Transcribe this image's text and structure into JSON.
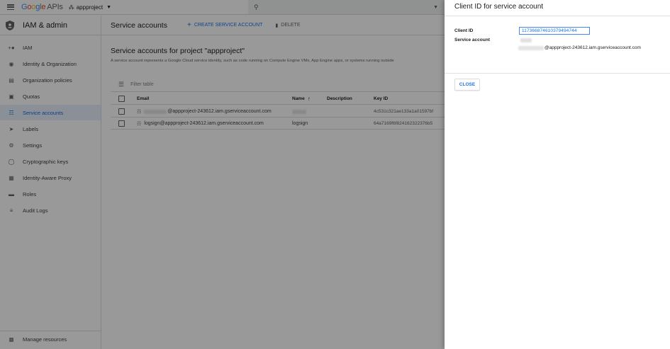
{
  "topbar": {
    "logo_letters": [
      "G",
      "o",
      "o",
      "g",
      "l",
      "e"
    ],
    "logo_suffix": "APIs",
    "project": "appproject",
    "icons": {
      "menu": "hamburger-icon",
      "search": "search-icon",
      "project": "project-dots-icon"
    }
  },
  "sidebar": {
    "title": "IAM & admin",
    "items": [
      {
        "label": "IAM",
        "icon": "person-add-icon"
      },
      {
        "label": "Identity & Organization",
        "icon": "account-circle-icon"
      },
      {
        "label": "Organization policies",
        "icon": "policy-doc-icon"
      },
      {
        "label": "Quotas",
        "icon": "quota-icon"
      },
      {
        "label": "Service accounts",
        "icon": "service-account-icon",
        "active": true
      },
      {
        "label": "Labels",
        "icon": "label-icon"
      },
      {
        "label": "Settings",
        "icon": "settings-gear-icon"
      },
      {
        "label": "Cryptographic keys",
        "icon": "crypto-key-icon"
      },
      {
        "label": "Identity-Aware Proxy",
        "icon": "proxy-icon"
      },
      {
        "label": "Roles",
        "icon": "roles-icon"
      },
      {
        "label": "Audit Logs",
        "icon": "audit-logs-icon"
      }
    ],
    "manage": "Manage resources"
  },
  "main": {
    "header": "Service accounts",
    "create_label": "CREATE SERVICE ACCOUNT",
    "delete_label": "DELETE",
    "section_title": "Service accounts for project \"appproject\"",
    "description": "A service account represents a Google Cloud service identity, such as code running on Compute Engine VMs, App Engine apps, or systems running outside",
    "filter_placeholder": "Filter table",
    "columns": {
      "email": "Email",
      "name": "Name",
      "description": "Description",
      "key_id": "Key ID"
    },
    "rows": [
      {
        "email_suffix": "@appproject-243612.iam.gserviceaccount.com",
        "name": "",
        "key_id": "4c531c321ae133a1a01597bf"
      },
      {
        "email_suffix": "logsign@appproject-243612.iam.gserviceaccount.com",
        "name": "logsign",
        "key_id": "64a7169f6f824162322376b5"
      }
    ]
  },
  "panel": {
    "title": "Client ID for service account",
    "client_id_label": "Client ID",
    "client_id_value": "117366874610379494744",
    "service_account_label": "Service account",
    "service_account_suffix": "@appproject-243612.iam.gserviceaccount.com",
    "close_label": "CLOSE"
  },
  "colors": {
    "accent": "#1a73e8",
    "active_bg": "#e8f0fe",
    "overlay": "rgba(0,0,0,0.40)"
  }
}
